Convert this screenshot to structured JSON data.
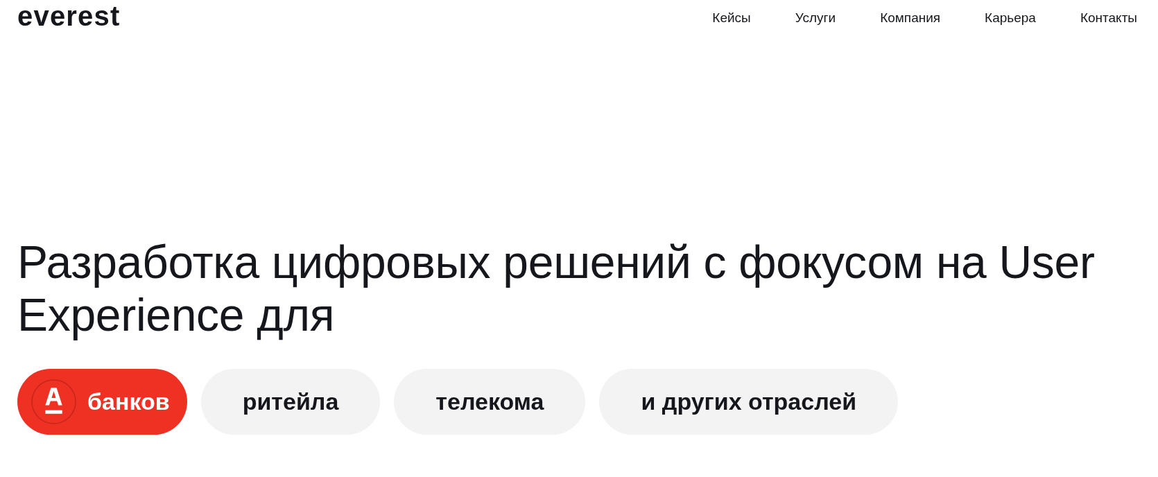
{
  "header": {
    "logo": "everest",
    "nav": [
      "Кейсы",
      "Услуги",
      "Компания",
      "Карьера",
      "Контакты"
    ]
  },
  "hero": {
    "headline": "Разработка цифровых решений с фокусом на User Experience для",
    "industries": [
      {
        "label": "банков",
        "selected": true
      },
      {
        "label": "ритейла",
        "selected": false
      },
      {
        "label": "телекома",
        "selected": false
      },
      {
        "label": "и других отраслей",
        "selected": false
      }
    ]
  }
}
